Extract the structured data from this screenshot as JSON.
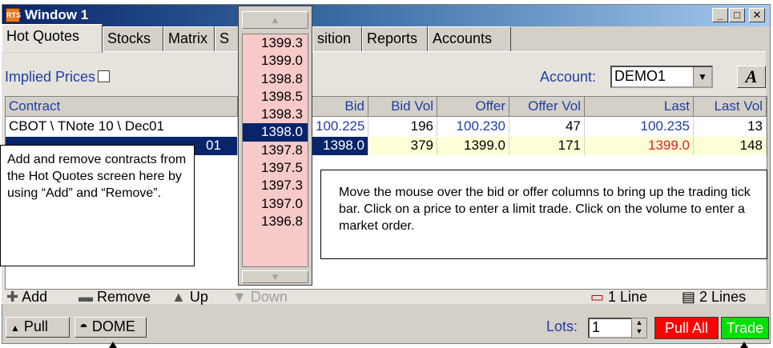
{
  "window": {
    "title": "Window 1",
    "app_icon_text": "RTS",
    "accent": "#0a246a"
  },
  "title_buttons": {
    "minimize": "_",
    "maximize": "□",
    "close": "✕"
  },
  "tabs": [
    "Hot Quotes",
    "Stocks",
    "Matrix",
    "S",
    "sition",
    "Reports",
    "Accounts"
  ],
  "implied_prices_label": "Implied Prices",
  "account": {
    "label": "Account:",
    "value": "DEMO1"
  },
  "font_button_label": "A",
  "columns": [
    "Contract",
    "Bid",
    "Bid Vol",
    "Offer",
    "Offer Vol",
    "Last",
    "Last Vol"
  ],
  "rows": [
    {
      "contract": "CBOT \\ TNote 10 \\ Dec01",
      "bid": "100.225",
      "bid_vol": "196",
      "offer": "100.230",
      "offer_vol": "47",
      "last": "100.235",
      "last_vol": "13"
    },
    {
      "contract": "01",
      "bid": "1398.0",
      "bid_vol": "379",
      "offer": "1399.0",
      "offer_vol": "171",
      "last": "1399.0",
      "last_vol": "148"
    }
  ],
  "tick_bar": {
    "prices": [
      "1399.3",
      "1399.0",
      "1398.8",
      "1398.5",
      "1398.3",
      "1398.0",
      "1397.8",
      "1397.5",
      "1397.3",
      "1397.0",
      "1396.8"
    ],
    "selected": "1398.0",
    "up_icon": "chevron-up-icon",
    "down_icon": "chevron-down-icon"
  },
  "callouts": {
    "left": "Add and remove contracts from the Hot Quotes screen here by using “Add” and “Remove”.",
    "center": "Move the mouse over the bid or offer columns to bring up the trading tick bar. Click on a price to enter a limit trade. Click on the volume to enter a market order."
  },
  "toolbar": {
    "add": "Add",
    "remove": "Remove",
    "up": "Up",
    "down": "Down",
    "one_line": "1 Line",
    "two_lines": "2 Lines"
  },
  "bottom": {
    "pull": "Pull",
    "dome": "DOME",
    "lots_label": "Lots:",
    "lots_value": "1",
    "pull_all": "Pull All",
    "trade": "Trade"
  },
  "colors": {
    "pull_all": "#ff0000",
    "trade": "#00e000",
    "tick_bar_bg": "#f7c9c9",
    "quote_blue": "#1f3fa5",
    "last_red": "#e02020"
  }
}
